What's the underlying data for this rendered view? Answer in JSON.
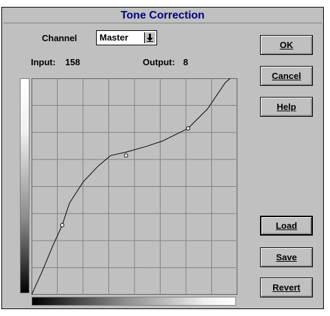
{
  "title": "Tone Correction",
  "channel": {
    "label": "Channel",
    "selected": "Master"
  },
  "readout": {
    "input_label": "Input:",
    "input_value": "158",
    "output_label": "Output:",
    "output_value": "8"
  },
  "buttons": {
    "ok": "OK",
    "cancel": "Cancel",
    "help": "Help",
    "load": "Load",
    "save": "Save",
    "revert": "Revert"
  },
  "curve": {
    "input_range": [
      0,
      255
    ],
    "output_range": [
      0,
      255
    ],
    "control_points": [
      {
        "in": 0,
        "out": 0
      },
      {
        "in": 38,
        "out": 82
      },
      {
        "in": 117,
        "out": 164
      },
      {
        "in": 194,
        "out": 196
      },
      {
        "in": 255,
        "out": 255
      }
    ],
    "path_points": [
      {
        "in": 0,
        "out": 0
      },
      {
        "in": 13,
        "out": 27
      },
      {
        "in": 26,
        "out": 57
      },
      {
        "in": 38,
        "out": 82
      },
      {
        "in": 47,
        "out": 108
      },
      {
        "in": 64,
        "out": 133
      },
      {
        "in": 83,
        "out": 152
      },
      {
        "in": 98,
        "out": 164
      },
      {
        "in": 117,
        "out": 168
      },
      {
        "in": 143,
        "out": 175
      },
      {
        "in": 162,
        "out": 181
      },
      {
        "in": 194,
        "out": 196
      },
      {
        "in": 218,
        "out": 219
      },
      {
        "in": 240,
        "out": 250
      },
      {
        "in": 251,
        "out": 259
      }
    ],
    "grid_divisions": 8
  }
}
